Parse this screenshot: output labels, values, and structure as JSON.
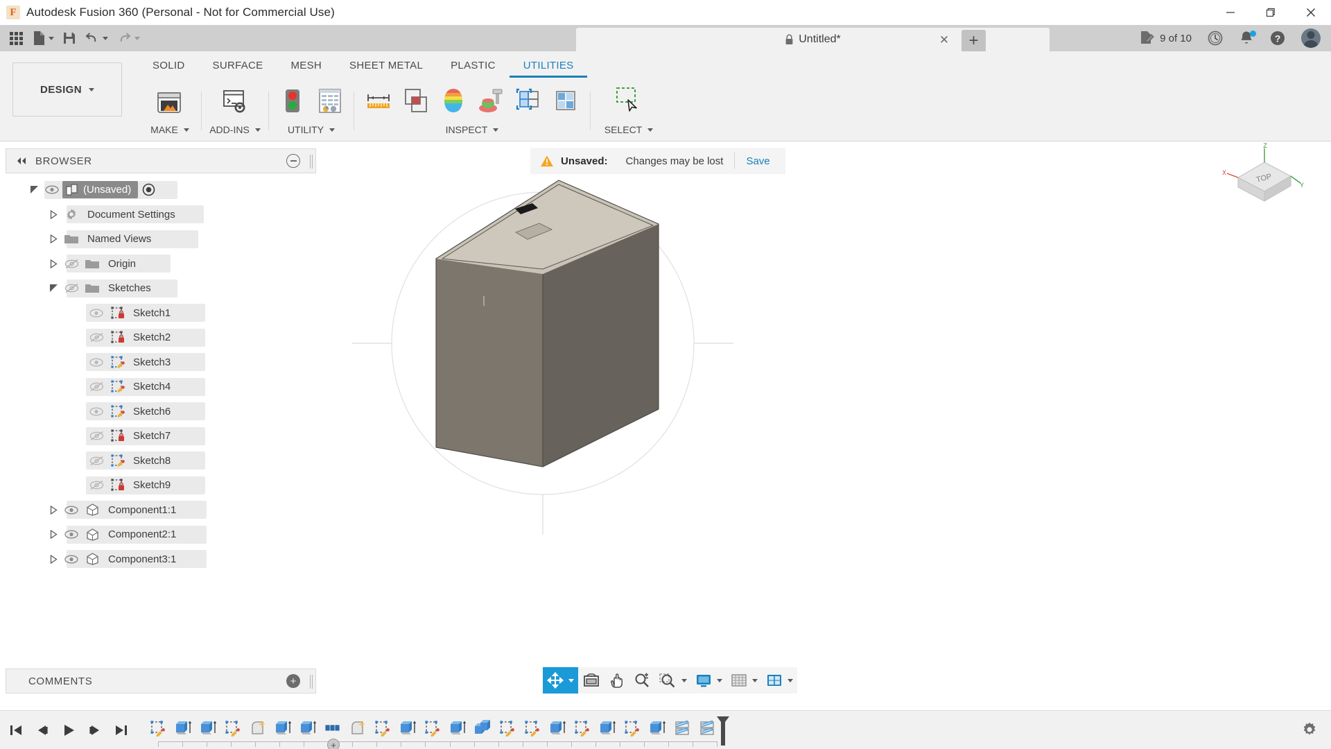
{
  "window": {
    "app_title": "Autodesk Fusion 360 (Personal - Not for Commercial Use)",
    "logo_letter": "F",
    "minimize_icon": "minimize-icon",
    "maximize_icon": "maximize-icon",
    "close_icon": "close-icon"
  },
  "quick_access": {
    "grid_icon": "app-grid-icon",
    "new_icon": "new-document-icon",
    "save_icon": "save-icon",
    "undo_icon": "undo-icon",
    "redo_icon": "redo-icon",
    "document_tab": {
      "title": "Untitled*",
      "lock_icon": "lock-icon",
      "close_icon": "close-icon"
    },
    "new_tab_label": "+",
    "job_status": "9 of 10",
    "job_icon": "jobs-pencil-icon",
    "history_icon": "clock-icon",
    "notifications_icon": "bell-icon",
    "help_icon": "help-icon",
    "account_icon": "avatar-icon"
  },
  "ribbon": {
    "workspace": {
      "label": "DESIGN",
      "caret_icon": "chevron-down-icon"
    },
    "tabs": [
      {
        "label": "SOLID",
        "active": false
      },
      {
        "label": "SURFACE",
        "active": false
      },
      {
        "label": "MESH",
        "active": false
      },
      {
        "label": "SHEET METAL",
        "active": false
      },
      {
        "label": "PLASTIC",
        "active": false
      },
      {
        "label": "UTILITIES",
        "active": true
      }
    ],
    "panels": [
      {
        "label": "MAKE",
        "has_caret": true,
        "tools": [
          {
            "name": "3d-print-icon"
          }
        ]
      },
      {
        "label": "ADD-INS",
        "has_caret": true,
        "tools": [
          {
            "name": "scripts-and-addins-icon"
          }
        ]
      },
      {
        "label": "UTILITY",
        "has_caret": true,
        "tools": [
          {
            "name": "compute-all-icon"
          },
          {
            "name": "show-data-panel-icon"
          }
        ]
      },
      {
        "label": "INSPECT",
        "has_caret": true,
        "tools": [
          {
            "name": "measure-icon"
          },
          {
            "name": "interference-icon"
          },
          {
            "name": "curvature-map-icon"
          },
          {
            "name": "zebra-analysis-icon"
          },
          {
            "name": "section-analysis-icon"
          },
          {
            "name": "display-component-colors-icon"
          }
        ]
      },
      {
        "label": "SELECT",
        "has_caret": true,
        "tools": [
          {
            "name": "window-selection-icon"
          }
        ]
      }
    ]
  },
  "browser": {
    "header_label": "BROWSER",
    "collapse_icon": "collapse-left-icon",
    "minimize_icon": "minimize-panel-icon",
    "tree": [
      {
        "label": "(Unsaved)",
        "indent": 0,
        "triangle": "expanded",
        "eye": "visible",
        "icon": "document-icon",
        "selected": true,
        "target_icon": "activate-icon"
      },
      {
        "label": "Document Settings",
        "indent": 1,
        "triangle": "collapsed",
        "eye": "none",
        "icon": "gear-icon",
        "selected": false
      },
      {
        "label": "Named Views",
        "indent": 1,
        "triangle": "collapsed",
        "eye": "none",
        "icon": "folder-icon",
        "selected": false
      },
      {
        "label": "Origin",
        "indent": 1,
        "triangle": "collapsed",
        "eye": "hidden",
        "icon": "folder-icon",
        "selected": false
      },
      {
        "label": "Sketches",
        "indent": 1,
        "triangle": "expanded",
        "eye": "hidden",
        "icon": "folder-icon",
        "selected": false
      },
      {
        "label": "Sketch1",
        "indent": 2,
        "triangle": "none",
        "eye": "visible",
        "icon": "sketch-locked-icon",
        "selected": false
      },
      {
        "label": "Sketch2",
        "indent": 2,
        "triangle": "none",
        "eye": "hidden",
        "icon": "sketch-locked-icon",
        "selected": false
      },
      {
        "label": "Sketch3",
        "indent": 2,
        "triangle": "none",
        "eye": "visible",
        "icon": "sketch-unlocked-icon",
        "selected": false
      },
      {
        "label": "Sketch4",
        "indent": 2,
        "triangle": "none",
        "eye": "hidden",
        "icon": "sketch-unlocked-icon",
        "selected": false
      },
      {
        "label": "Sketch6",
        "indent": 2,
        "triangle": "none",
        "eye": "visible",
        "icon": "sketch-unlocked-icon",
        "selected": false
      },
      {
        "label": "Sketch7",
        "indent": 2,
        "triangle": "none",
        "eye": "hidden",
        "icon": "sketch-locked-icon",
        "selected": false
      },
      {
        "label": "Sketch8",
        "indent": 2,
        "triangle": "none",
        "eye": "hidden",
        "icon": "sketch-unlocked-icon",
        "selected": false
      },
      {
        "label": "Sketch9",
        "indent": 2,
        "triangle": "none",
        "eye": "hidden",
        "icon": "sketch-locked-icon",
        "selected": false
      },
      {
        "label": "Component1:1",
        "indent": 1,
        "triangle": "collapsed",
        "eye": "visible",
        "icon": "component-icon",
        "selected": false
      },
      {
        "label": "Component2:1",
        "indent": 1,
        "triangle": "collapsed",
        "eye": "visible",
        "icon": "component-icon",
        "selected": false
      },
      {
        "label": "Component3:1",
        "indent": 1,
        "triangle": "collapsed",
        "eye": "visible",
        "icon": "component-icon",
        "selected": false
      }
    ]
  },
  "comments": {
    "label": "COMMENTS",
    "add_icon": "add-comment-icon"
  },
  "banner": {
    "warning_icon": "warning-triangle-icon",
    "title": "Unsaved:",
    "message": "Changes may be lost",
    "action": "Save"
  },
  "viewcube": {
    "top_label": "TOP",
    "axis_x": "X",
    "axis_y": "Y",
    "axis_z": "Z",
    "home_icon": "home-icon"
  },
  "navbar": {
    "items": [
      {
        "name": "orbit-icon",
        "selected": true,
        "caret": true
      },
      {
        "name": "look-at-icon",
        "selected": false,
        "caret": false
      },
      {
        "name": "pan-icon",
        "selected": false,
        "caret": false
      },
      {
        "name": "zoom-icon",
        "selected": false,
        "caret": false
      },
      {
        "name": "fit-icon",
        "selected": false,
        "caret": true
      },
      {
        "name": "display-settings-icon",
        "selected": false,
        "caret": true
      },
      {
        "name": "grid-and-snaps-icon",
        "selected": false,
        "caret": true
      },
      {
        "name": "viewports-icon",
        "selected": false,
        "caret": true
      }
    ]
  },
  "timeline": {
    "playback": [
      {
        "name": "go-to-beginning-icon"
      },
      {
        "name": "step-back-icon"
      },
      {
        "name": "play-icon"
      },
      {
        "name": "step-forward-icon"
      },
      {
        "name": "go-to-end-icon"
      }
    ],
    "features": [
      {
        "name": "sketch-feature-icon",
        "type": "sketch"
      },
      {
        "name": "extrude-feature-icon",
        "type": "extrude"
      },
      {
        "name": "extrude-feature-icon",
        "type": "extrude"
      },
      {
        "name": "sketch-feature-icon",
        "type": "sketch"
      },
      {
        "name": "fillet-feature-icon",
        "type": "fillet"
      },
      {
        "name": "extrude-feature-icon",
        "type": "extrude"
      },
      {
        "name": "extrude-feature-icon",
        "type": "extrude"
      },
      {
        "name": "pattern-feature-icon",
        "type": "pattern"
      },
      {
        "name": "fillet-feature-icon",
        "type": "fillet"
      },
      {
        "name": "sketch-feature-icon",
        "type": "sketch"
      },
      {
        "name": "extrude-feature-icon",
        "type": "extrude"
      },
      {
        "name": "sketch-feature-icon",
        "type": "sketch"
      },
      {
        "name": "extrude-feature-icon",
        "type": "extrude"
      },
      {
        "name": "combine-feature-icon",
        "type": "combine"
      },
      {
        "name": "sketch-feature-icon",
        "type": "sketch"
      },
      {
        "name": "sketch-feature-icon",
        "type": "sketch"
      },
      {
        "name": "extrude-feature-icon",
        "type": "extrude"
      },
      {
        "name": "sketch-feature-icon",
        "type": "sketch"
      },
      {
        "name": "extrude-feature-icon",
        "type": "extrude"
      },
      {
        "name": "sketch-feature-icon",
        "type": "sketch"
      },
      {
        "name": "extrude-feature-icon",
        "type": "extrude"
      },
      {
        "name": "thread-feature-icon",
        "type": "thread"
      },
      {
        "name": "thread-feature-icon",
        "type": "thread"
      }
    ],
    "marker_label": "+",
    "end_marker_icon": "timeline-end-marker-icon",
    "settings_icon": "gear-icon"
  },
  "colors": {
    "accent_blue": "#1a7fba",
    "nav_selected": "#1a9ad6",
    "warning_orange": "#f5a623",
    "titlebar_bg": "#ffffff",
    "qabar_bg": "#cfcfcf",
    "ribbon_bg": "#f1f1f1",
    "model_top_face": "#c8c2b6",
    "model_left_face": "#807a70",
    "model_right_face": "#6e6963"
  }
}
